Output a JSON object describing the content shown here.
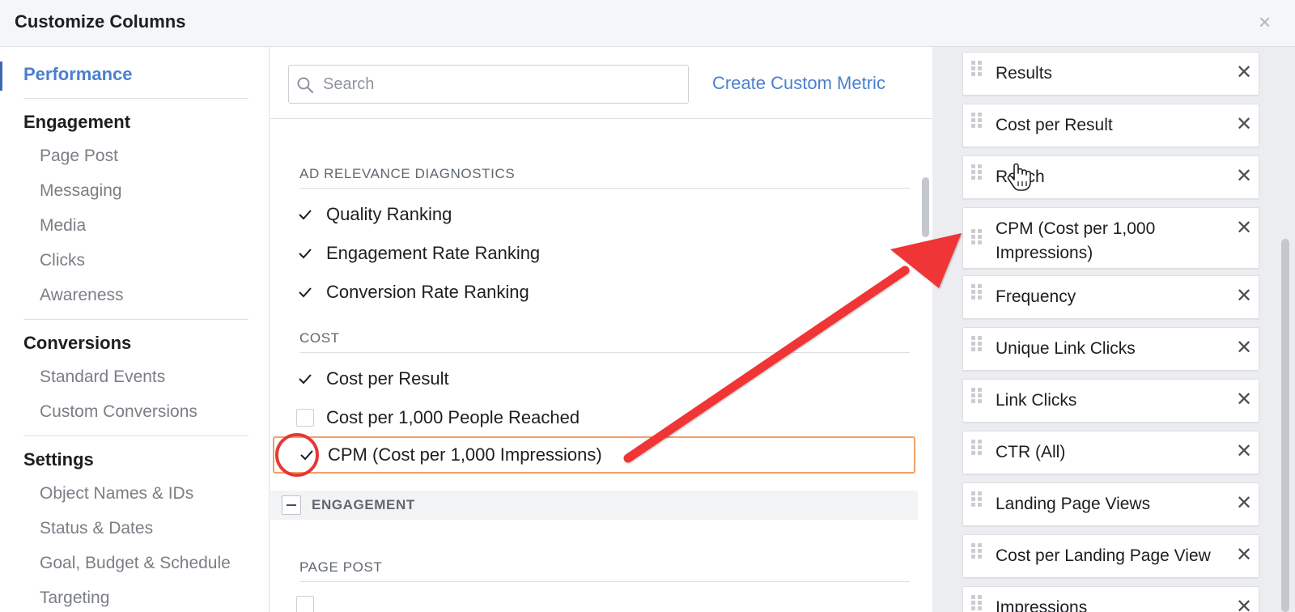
{
  "header": {
    "title": "Customize Columns",
    "close_glyph": "×"
  },
  "sidebar": {
    "groups": [
      {
        "heading": "Performance",
        "active": true,
        "items": []
      },
      {
        "heading": "Engagement",
        "items": [
          "Page Post",
          "Messaging",
          "Media",
          "Clicks",
          "Awareness"
        ]
      },
      {
        "heading": "Conversions",
        "items": [
          "Standard Events",
          "Custom Conversions"
        ]
      },
      {
        "heading": "Settings",
        "items": [
          "Object Names & IDs",
          "Status & Dates",
          "Goal, Budget & Schedule",
          "Targeting"
        ]
      }
    ]
  },
  "middle": {
    "search": {
      "placeholder": "Search",
      "value": ""
    },
    "create_custom_metric": "Create Custom Metric",
    "sections": [
      {
        "label": "AD RELEVANCE DIAGNOSTICS",
        "metrics": [
          {
            "label": "Quality Ranking",
            "checked": true
          },
          {
            "label": "Engagement Rate Ranking",
            "checked": true
          },
          {
            "label": "Conversion Rate Ranking",
            "checked": true
          }
        ]
      },
      {
        "label": "COST",
        "metrics": [
          {
            "label": "Cost per Result",
            "checked": true
          },
          {
            "label": "Cost per 1,000 People Reached",
            "checked": false
          },
          {
            "label": "CPM (Cost per 1,000 Impressions)",
            "checked": true,
            "highlighted": true
          }
        ]
      }
    ],
    "engagement_group": "ENGAGEMENT",
    "page_post_section": "PAGE POST"
  },
  "selected_columns": [
    "Results",
    "Cost per Result",
    "Reach",
    "CPM (Cost per 1,000 Impressions)",
    "Frequency",
    "Unique Link Clicks",
    "Link Clicks",
    "CTR (All)",
    "Landing Page Views",
    "Cost per Landing Page View",
    "Impressions"
  ],
  "icons": {
    "search": "search-icon",
    "check": "check-icon",
    "remove": "close-icon",
    "drag": "drag-handle-icon",
    "collapse": "minus-icon",
    "cursor": "hand-pointer-icon"
  },
  "colors": {
    "accent_blue": "#4a7fcf",
    "annotation_red": "#e53935",
    "highlight_orange": "#f0a06a",
    "right_panel_bg": "#ebedf0"
  }
}
